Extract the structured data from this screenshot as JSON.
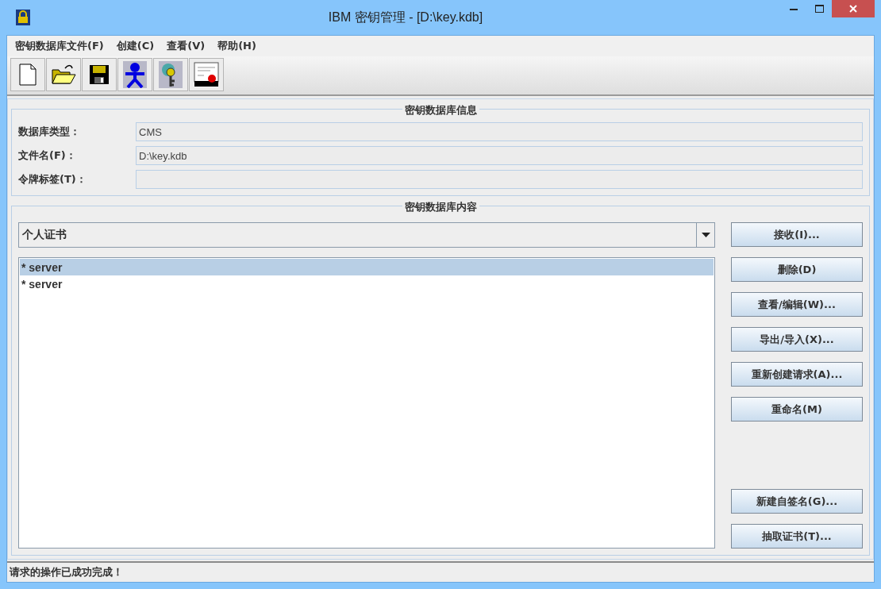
{
  "window": {
    "title": "IBM 密钥管理 - [D:\\key.kdb]"
  },
  "menu": [
    {
      "label": "密钥数据库文件(F)"
    },
    {
      "label": "创建(C)"
    },
    {
      "label": "查看(V)"
    },
    {
      "label": "帮助(H)"
    }
  ],
  "toolbar": [
    {
      "kind": "new"
    },
    {
      "kind": "open"
    },
    {
      "kind": "save"
    },
    {
      "kind": "person"
    },
    {
      "kind": "key"
    },
    {
      "kind": "certificate"
    }
  ],
  "info": {
    "title": "密钥数据库信息",
    "fields": [
      {
        "label": "数据库类型：",
        "value": "CMS"
      },
      {
        "label": "文件名(F)：",
        "value": "D:\\key.kdb"
      },
      {
        "label": "令牌标签(T)："
      }
    ]
  },
  "content": {
    "title": "密钥数据库内容",
    "dropdown": {
      "value": "个人证书"
    },
    "items": [
      {
        "label": "* server",
        "selected": true
      },
      {
        "label": "* server",
        "selected": false
      }
    ],
    "buttons_top": [
      {
        "label": "接收(I)..."
      },
      {
        "label": "删除(D)"
      },
      {
        "label": "查看/编辑(W)..."
      },
      {
        "label": "导出/导入(X)..."
      },
      {
        "label": "重新创建请求(A)..."
      },
      {
        "label": "重命名(M)"
      }
    ],
    "buttons_bottom": [
      {
        "label": "新建自签名(G)..."
      },
      {
        "label": "抽取证书(T)..."
      }
    ]
  },
  "status_bar": "请求的操作已成功完成！"
}
